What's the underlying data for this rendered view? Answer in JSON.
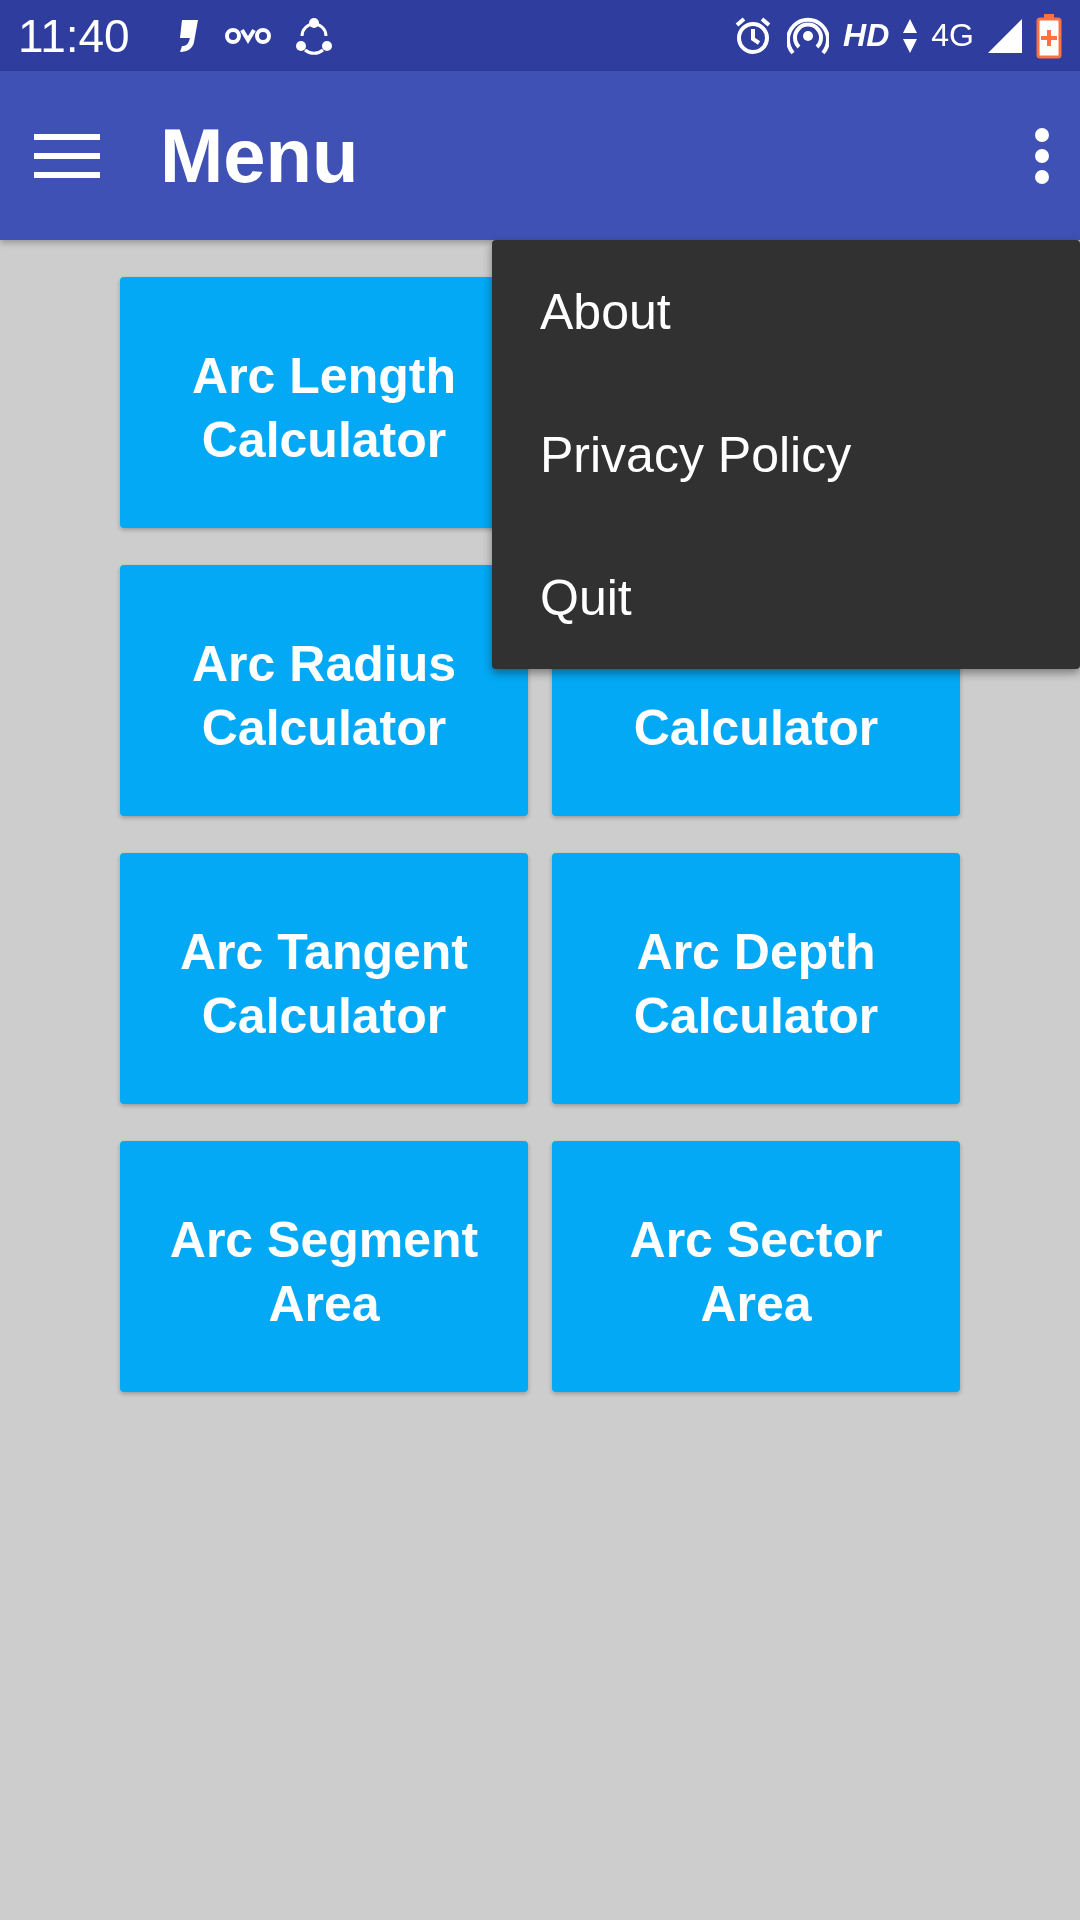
{
  "status_bar": {
    "time": "11:40",
    "network_label": "HD",
    "network_type": "4G"
  },
  "app_bar": {
    "title": "Menu"
  },
  "tiles": [
    {
      "lines": [
        "Arc Length",
        "Calculator"
      ]
    },
    {
      "lines": [
        "Arc Radius",
        "Calculator"
      ]
    },
    {
      "lines": [
        "Calculator"
      ]
    },
    {
      "lines": [
        "Arc Tangent",
        "Calculator"
      ]
    },
    {
      "lines": [
        "Arc Depth",
        "Calculator"
      ]
    },
    {
      "lines": [
        "Arc Segment",
        "Area"
      ]
    },
    {
      "lines": [
        "Arc Sector",
        "Area"
      ]
    }
  ],
  "overflow_menu": {
    "items": [
      "About",
      "Privacy Policy",
      "Quit"
    ]
  }
}
